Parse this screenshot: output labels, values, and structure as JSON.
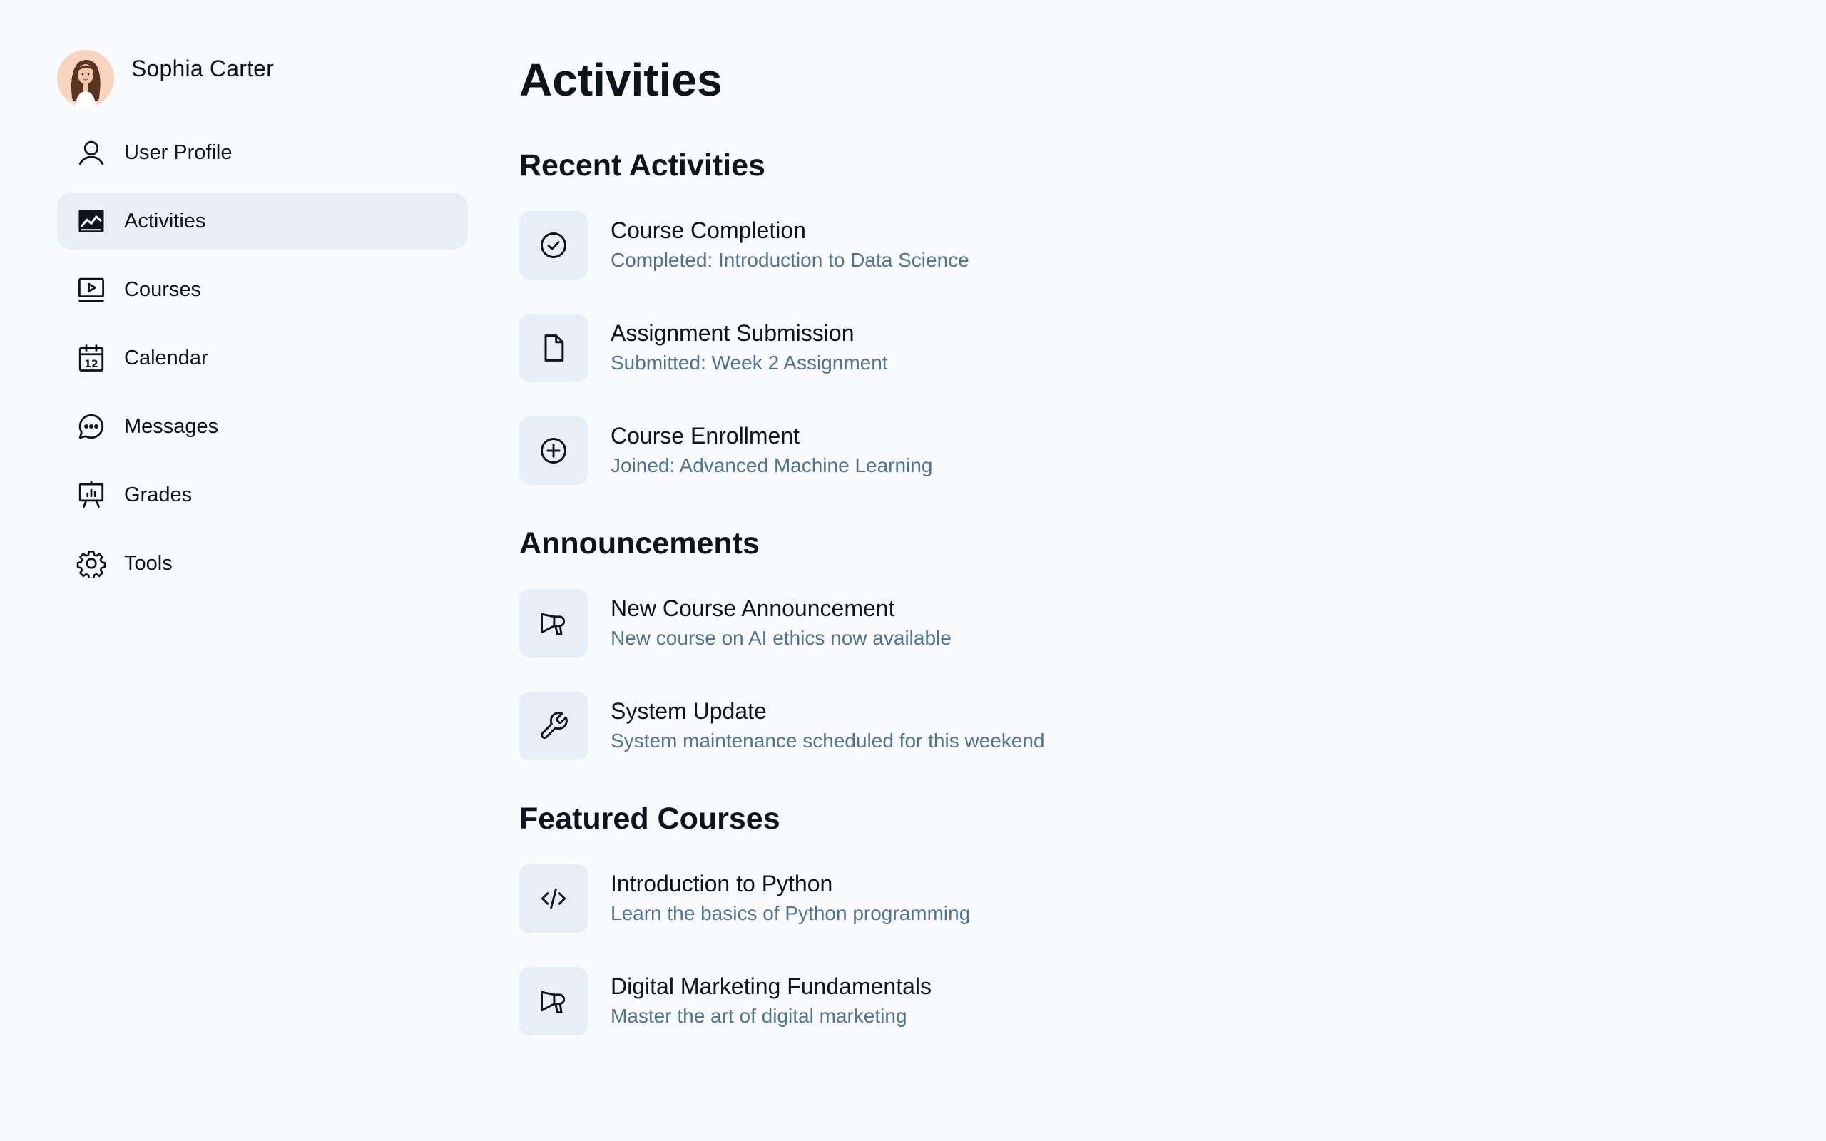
{
  "profile": {
    "name": "Sophia Carter"
  },
  "sidebar": {
    "items": [
      {
        "label": "User Profile",
        "icon": "user-icon",
        "active": false
      },
      {
        "label": "Activities",
        "icon": "chart-line-icon",
        "active": true
      },
      {
        "label": "Courses",
        "icon": "monitor-play-icon",
        "active": false
      },
      {
        "label": "Calendar",
        "icon": "calendar-icon",
        "active": false
      },
      {
        "label": "Messages",
        "icon": "chat-icon",
        "active": false
      },
      {
        "label": "Grades",
        "icon": "presentation-chart-icon",
        "active": false
      },
      {
        "label": "Tools",
        "icon": "gear-icon",
        "active": false
      }
    ]
  },
  "main": {
    "title": "Activities",
    "recent": {
      "title": "Recent Activities",
      "items": [
        {
          "title": "Course Completion",
          "subtitle": "Completed: Introduction to Data Science",
          "icon": "check-circle-icon"
        },
        {
          "title": "Assignment Submission",
          "subtitle": "Submitted: Week 2 Assignment",
          "icon": "file-icon"
        },
        {
          "title": "Course Enrollment",
          "subtitle": "Joined: Advanced Machine Learning",
          "icon": "plus-circle-icon"
        }
      ]
    },
    "announcements": {
      "title": "Announcements",
      "items": [
        {
          "title": "New Course Announcement",
          "subtitle": "New course on AI ethics now available",
          "icon": "megaphone-icon"
        },
        {
          "title": "System Update",
          "subtitle": "System maintenance scheduled for this weekend",
          "icon": "wrench-icon"
        }
      ]
    },
    "featured": {
      "title": "Featured Courses",
      "items": [
        {
          "title": "Introduction to Python",
          "subtitle": "Learn the basics of Python programming",
          "icon": "code-icon"
        },
        {
          "title": "Digital Marketing Fundamentals",
          "subtitle": "Master the art of digital marketing",
          "icon": "megaphone-icon"
        }
      ]
    }
  },
  "colors": {
    "background": "#f8fafc",
    "active_nav": "#e8eef5",
    "icon_tile": "#e8eef5",
    "text_primary": "#0e141b",
    "text_secondary": "#4e7397"
  }
}
